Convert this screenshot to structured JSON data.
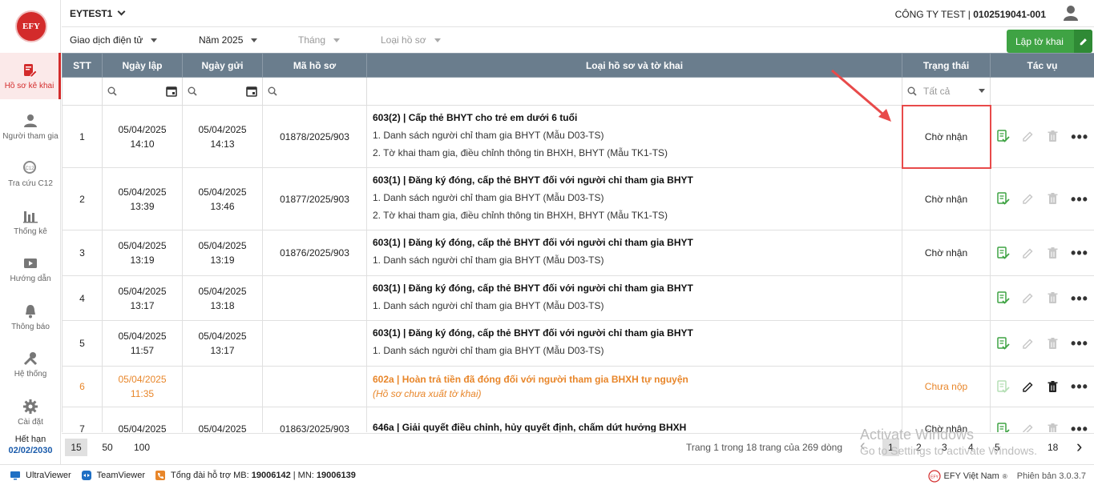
{
  "sidebar": {
    "logo": "EFY",
    "items": [
      {
        "label": "Hồ sơ kê khai",
        "icon": "edit-document-icon"
      },
      {
        "label": "Người tham gia",
        "icon": "person-icon"
      },
      {
        "label": "Tra cứu C12",
        "icon": "search-c12-icon"
      },
      {
        "label": "Thống kê",
        "icon": "bar-chart-icon"
      },
      {
        "label": "Hướng dẫn",
        "icon": "guide-video-icon"
      },
      {
        "label": "Thông báo",
        "icon": "bell-icon"
      },
      {
        "label": "Hệ thống",
        "icon": "tools-icon"
      },
      {
        "label": "Cài đặt",
        "icon": "gear-icon"
      }
    ],
    "expire_label": "Hết hạn",
    "expire_date": "02/02/2030"
  },
  "header": {
    "workspace": "EYTEST1",
    "company_name": "CÔNG TY TEST | ",
    "company_code": "0102519041-001"
  },
  "filters": {
    "type": "Giao dịch điện tử",
    "year": "Năm 2025",
    "month": "Tháng",
    "doc_type": "Loại hồ sơ",
    "create_button": "Lập tờ khai"
  },
  "table": {
    "columns": [
      "STT",
      "Ngày lập",
      "Ngày gửi",
      "Mã hồ sơ",
      "Loại hồ sơ và tờ khai",
      "Trạng thái",
      "Tác vụ"
    ],
    "status_filter_placeholder": "Tất cả",
    "rows": [
      {
        "stt": "1",
        "created_date": "05/04/2025",
        "created_time": "14:10",
        "sent_date": "05/04/2025",
        "sent_time": "14:13",
        "code": "01878/2025/903",
        "title": "603(2) | Cấp thẻ BHYT cho trẻ em dưới 6 tuổi",
        "lines": [
          "1. Danh sách người chỉ tham gia BHYT (Mẫu D03-TS)",
          "2. Tờ khai tham gia, điều chỉnh thông tin BHXH, BHYT (Mẫu TK1-TS)"
        ],
        "status": "Chờ nhận"
      },
      {
        "stt": "2",
        "created_date": "05/04/2025",
        "created_time": "13:39",
        "sent_date": "05/04/2025",
        "sent_time": "13:46",
        "code": "01877/2025/903",
        "title": "603(1) | Đăng ký đóng, cấp thẻ BHYT đối với người chỉ tham gia BHYT",
        "lines": [
          "1. Danh sách người chỉ tham gia BHYT (Mẫu D03-TS)",
          "2. Tờ khai tham gia, điều chỉnh thông tin BHXH, BHYT (Mẫu TK1-TS)"
        ],
        "status": "Chờ nhận"
      },
      {
        "stt": "3",
        "created_date": "05/04/2025",
        "created_time": "13:19",
        "sent_date": "05/04/2025",
        "sent_time": "13:19",
        "code": "01876/2025/903",
        "title": "603(1) | Đăng ký đóng, cấp thẻ BHYT đối với người chỉ tham gia BHYT",
        "lines": [
          "1. Danh sách người chỉ tham gia BHYT (Mẫu D03-TS)"
        ],
        "status": "Chờ nhận"
      },
      {
        "stt": "4",
        "created_date": "05/04/2025",
        "created_time": "13:17",
        "sent_date": "05/04/2025",
        "sent_time": "13:18",
        "code": "",
        "title": "603(1) | Đăng ký đóng, cấp thẻ BHYT đối với người chỉ tham gia BHYT",
        "lines": [
          "1. Danh sách người chỉ tham gia BHYT (Mẫu D03-TS)"
        ],
        "status": ""
      },
      {
        "stt": "5",
        "created_date": "05/04/2025",
        "created_time": "11:57",
        "sent_date": "05/04/2025",
        "sent_time": "13:17",
        "code": "",
        "title": "603(1) | Đăng ký đóng, cấp thẻ BHYT đối với người chỉ tham gia BHYT",
        "lines": [
          "1. Danh sách người chỉ tham gia BHYT (Mẫu D03-TS)"
        ],
        "status": ""
      },
      {
        "stt": "6",
        "created_date": "05/04/2025",
        "created_time": "11:35",
        "sent_date": "",
        "sent_time": "",
        "code": "",
        "title": "602a | Hoàn trả tiền đã đóng đối với người tham gia BHXH tự nguyện",
        "note": "(Hồ sơ chưa xuất tờ khai)",
        "lines": [],
        "status": "Chưa nộp"
      },
      {
        "stt": "7",
        "created_date": "05/04/2025",
        "created_time": "",
        "sent_date": "05/04/2025",
        "sent_time": "",
        "code": "01863/2025/903",
        "title": "646a | Giải quyết điều chỉnh, hủy quyết định, chấm dứt hưởng BHXH",
        "lines": [],
        "status": "Chờ nhận"
      }
    ]
  },
  "pager": {
    "sizes": [
      "15",
      "50",
      "100"
    ],
    "info": "Trang 1 trong 18 trang của 269 dòng",
    "pages": [
      "1",
      "2",
      "3",
      "4",
      "5",
      "18"
    ],
    "prev": "‹",
    "next": "›"
  },
  "bottom": {
    "ultraviewer": "UltraViewer",
    "teamviewer": "TeamViewer",
    "hotline_label": "Tổng đài hỗ trợ MB: ",
    "hotline_mb": "19006142",
    "hotline_sep": " | MN: ",
    "hotline_mn": "19006139",
    "brand": "EFY Việt Nam",
    "version": "Phiên bản 3.0.3.7"
  },
  "watermark": {
    "line1": "Activate Windows",
    "line2": "Go to Settings to activate Windows."
  },
  "colors": {
    "brand_red": "#d32b2b",
    "header_gray": "#6a7d8d",
    "green": "#3fa344",
    "orange": "#e8862a",
    "highlight": "#e84a4a"
  }
}
